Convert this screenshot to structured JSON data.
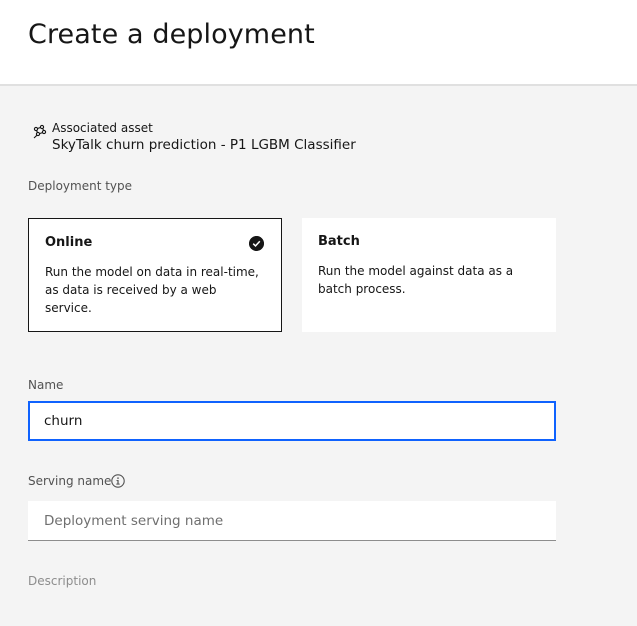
{
  "header": {
    "title": "Create a deployment"
  },
  "asset": {
    "icon": "model-icon",
    "label": "Associated asset",
    "value": "SkyTalk churn prediction - P1 LGBM Classifier"
  },
  "deployment_type": {
    "label": "Deployment type",
    "options": [
      {
        "title": "Online",
        "description": "Run the model on data in real-time, as data is received by a web service.",
        "selected": true
      },
      {
        "title": "Batch",
        "description": "Run the model against data as a batch process.",
        "selected": false
      }
    ]
  },
  "name_field": {
    "label": "Name",
    "value": "churn"
  },
  "serving_name_field": {
    "label": "Serving name",
    "placeholder": "Deployment serving name",
    "icon": "information-icon"
  },
  "description_field": {
    "label": "Description"
  },
  "colors": {
    "accent": "#0f62fe",
    "selected_border": "#161616",
    "background": "#f4f4f4"
  }
}
